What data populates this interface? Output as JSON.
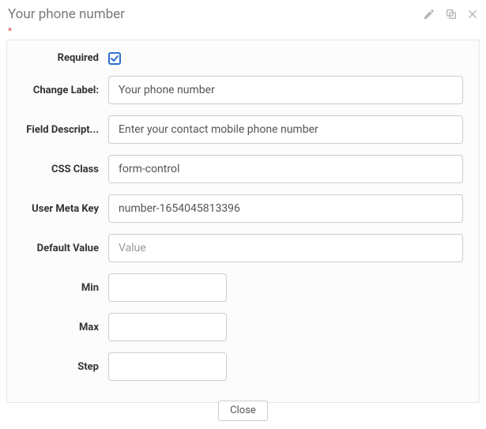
{
  "header": {
    "title": "Your phone number",
    "required_mark": "*"
  },
  "labels": {
    "required": "Required",
    "change_label": "Change Label:",
    "field_description": "Field Descript...",
    "css_class": "CSS Class",
    "user_meta_key": "User Meta Key",
    "default_value": "Default Value",
    "min": "Min",
    "max": "Max",
    "step": "Step"
  },
  "fields": {
    "required_checked": true,
    "change_label": "Your phone number",
    "field_description": "Enter your contact mobile phone number",
    "css_class": "form-control",
    "user_meta_key": "number-1654045813396",
    "default_value_placeholder": "Value",
    "default_value": "",
    "min": "",
    "max": "",
    "step": ""
  },
  "footer": {
    "close": "Close"
  }
}
